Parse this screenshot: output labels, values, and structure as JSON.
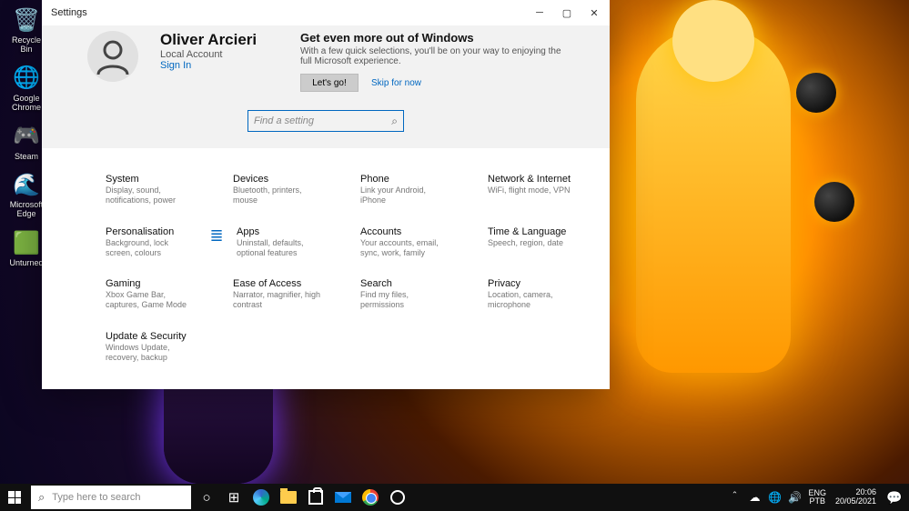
{
  "desktop_icons": [
    {
      "name": "recycle-bin",
      "label": "Recycle Bin",
      "glyph": "🗑️"
    },
    {
      "name": "google-chrome",
      "label": "Google Chrome",
      "glyph": "🌐"
    },
    {
      "name": "steam",
      "label": "Steam",
      "glyph": "🎮"
    },
    {
      "name": "microsoft-edge",
      "label": "Microsoft Edge",
      "glyph": "🌊"
    },
    {
      "name": "unturned",
      "label": "Unturned",
      "glyph": "🟩"
    }
  ],
  "settings": {
    "window_title": "Settings",
    "user": {
      "name": "Oliver Arcieri",
      "type": "Local Account",
      "signin": "Sign In"
    },
    "promo": {
      "title": "Get even more out of Windows",
      "subtitle": "With a few quick selections, you'll be on your way to enjoying the full Microsoft experience.",
      "letsgo": "Let's go!",
      "skip": "Skip for now"
    },
    "search_placeholder": "Find a setting",
    "categories": [
      {
        "title": "System",
        "desc": "Display, sound, notifications, power"
      },
      {
        "title": "Devices",
        "desc": "Bluetooth, printers, mouse"
      },
      {
        "title": "Phone",
        "desc": "Link your Android, iPhone"
      },
      {
        "title": "Network & Internet",
        "desc": "WiFi, flight mode, VPN"
      },
      {
        "title": "Personalisation",
        "desc": "Background, lock screen, colours"
      },
      {
        "title": "Apps",
        "desc": "Uninstall, defaults, optional features"
      },
      {
        "title": "Accounts",
        "desc": "Your accounts, email, sync, work, family"
      },
      {
        "title": "Time & Language",
        "desc": "Speech, region, date"
      },
      {
        "title": "Gaming",
        "desc": "Xbox Game Bar, captures, Game Mode"
      },
      {
        "title": "Ease of Access",
        "desc": "Narrator, magnifier, high contrast"
      },
      {
        "title": "Search",
        "desc": "Find my files, permissions"
      },
      {
        "title": "Privacy",
        "desc": "Location, camera, microphone"
      },
      {
        "title": "Update & Security",
        "desc": "Windows Update, recovery, backup"
      }
    ]
  },
  "taskbar": {
    "search_placeholder": "Type here to search",
    "lang_top": "ENG",
    "lang_bottom": "PTB",
    "time": "20:06",
    "date": "20/05/2021"
  }
}
